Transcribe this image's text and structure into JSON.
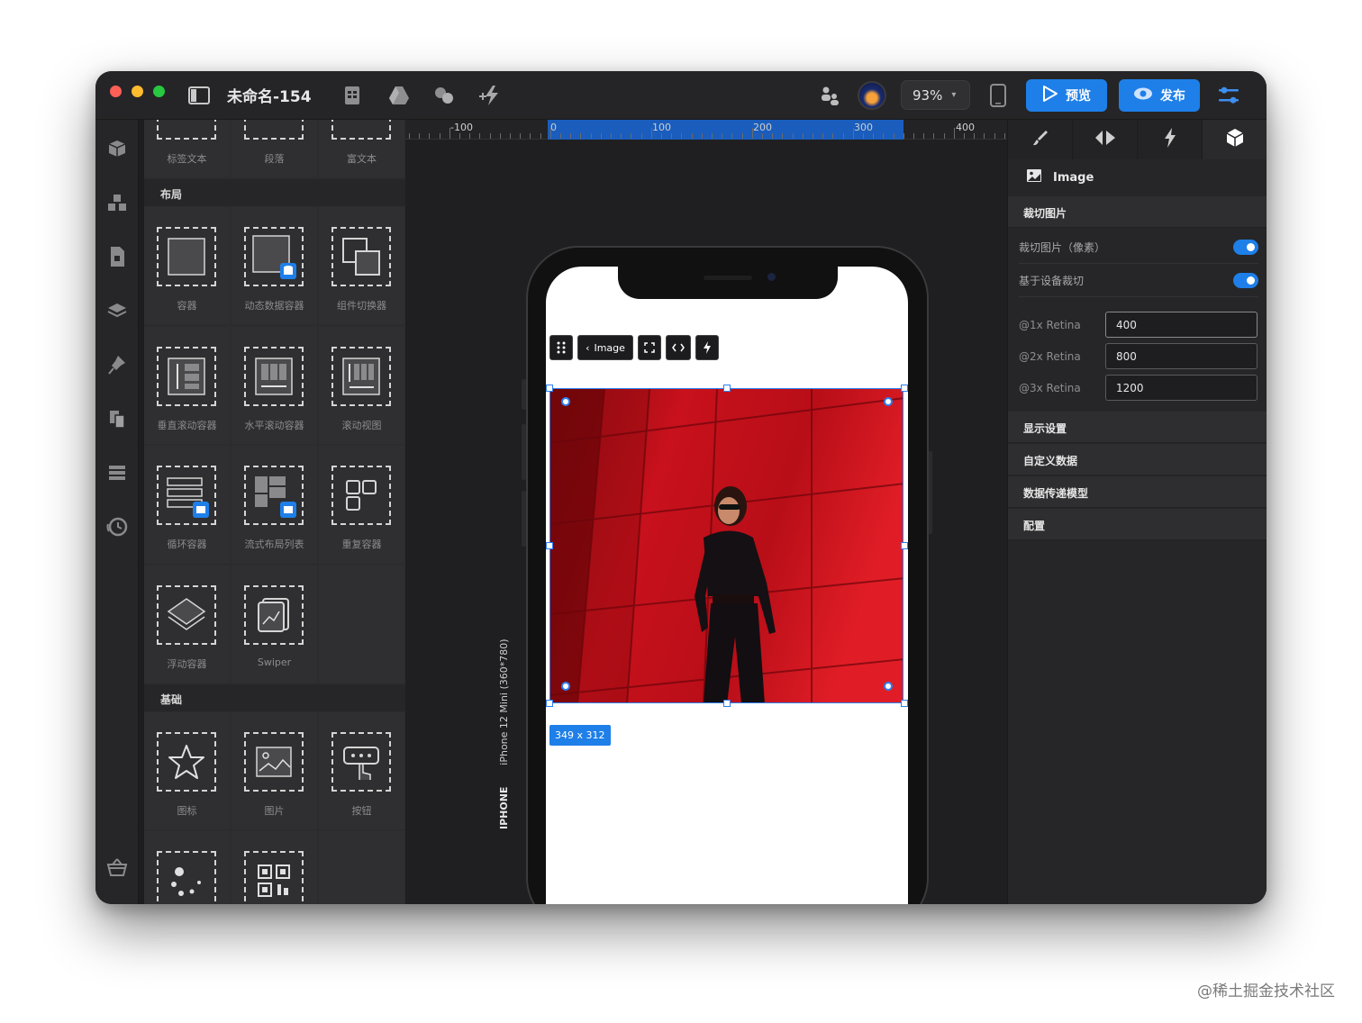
{
  "window": {
    "title": "未命名-154",
    "zoom": "93%",
    "preview_label": "预览",
    "publish_label": "发布"
  },
  "panel": {
    "top_items": [
      "标签文本",
      "段落",
      "富文本"
    ],
    "layout_header": "布局",
    "layout_items": [
      "容器",
      "动态数据容器",
      "组件切换器",
      "垂直滚动容器",
      "水平滚动容器",
      "滚动视图",
      "循环容器",
      "流式布局列表",
      "重复容器",
      "浮动容器",
      "Swiper"
    ],
    "basic_header": "基础",
    "basic_items": [
      "图标",
      "图片",
      "按钮"
    ]
  },
  "canvas": {
    "ruler_labels": [
      "-100",
      "0",
      "100",
      "200",
      "300",
      "400"
    ],
    "device_type": "IPHONE",
    "device_name": "iPhone 12 Mini (360*780)",
    "toolbar_label": "Image",
    "size_badge": "349 x 312"
  },
  "inspector": {
    "component_name": "Image",
    "crop_section": "裁切图片",
    "crop_px_label": "裁切图片（像素）",
    "crop_device_label": "基于设备裁切",
    "crop_px_on": true,
    "crop_device_on": true,
    "retina": [
      {
        "label": "@1x Retina",
        "value": "400"
      },
      {
        "label": "@2x Retina",
        "value": "800"
      },
      {
        "label": "@3x Retina",
        "value": "1200"
      }
    ],
    "sections": [
      "显示设置",
      "自定义数据",
      "数据传递模型",
      "配置"
    ]
  },
  "watermark": "@稀土掘金技术社区",
  "colors": {
    "accent": "#1e7fe8",
    "photo_red": "#c5121c"
  }
}
